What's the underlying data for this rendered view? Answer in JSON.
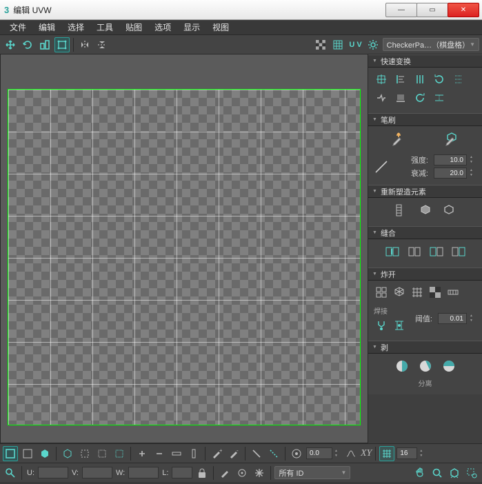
{
  "window": {
    "app_icon_text": "3",
    "title": "编辑 UVW"
  },
  "menu": [
    "文件",
    "编辑",
    "选择",
    "工具",
    "贴图",
    "选项",
    "显示",
    "视图"
  ],
  "top_toolbar": {
    "uv_label": "U V",
    "map_dropdown": "CheckerPa…（棋盘格）"
  },
  "panels": {
    "quick_transform": {
      "title": "快速变换"
    },
    "brush": {
      "title": "笔刷",
      "strength_label": "强度:",
      "strength_value": "10.0",
      "falloff_label": "衰减:",
      "falloff_value": "20.0"
    },
    "reshape": {
      "title": "重新塑造元素"
    },
    "stitch": {
      "title": "缝合"
    },
    "explode": {
      "title": "炸开",
      "weld_label": "焊接",
      "threshold_label": "阈值:",
      "threshold_value": "0.01"
    },
    "peel": {
      "title": "剥",
      "separate_label": "分离"
    }
  },
  "chart_data": {
    "type": "grid",
    "extent": [
      0,
      1
    ],
    "grid_divisions_major": 8,
    "checker_tiles": 20,
    "border_color": "#00ff00"
  },
  "bottom_toolbar": {
    "rotation_value": "0.0",
    "xy_label": "XY",
    "grid_value": "16"
  },
  "status": {
    "u_label": "U:",
    "u_value": "",
    "v_label": "V:",
    "v_value": "",
    "w_label": "W:",
    "w_value": "",
    "l_label": "L:",
    "l_value": "",
    "id_dropdown": "所有 ID"
  }
}
